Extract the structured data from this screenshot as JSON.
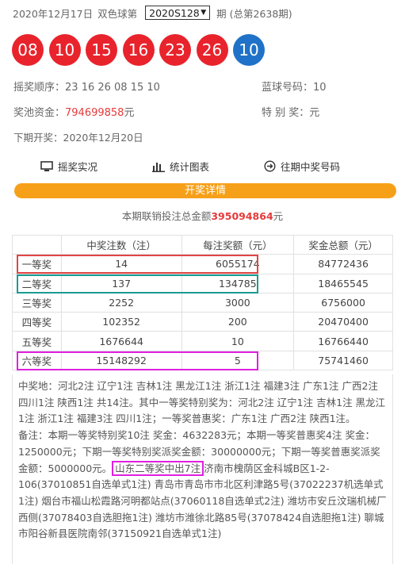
{
  "header": {
    "date": "2020年12月17日",
    "game": "双色球第",
    "issue": "2020S128",
    "suffix": "期 (总第2638期)"
  },
  "balls": {
    "red": [
      "08",
      "10",
      "15",
      "16",
      "23",
      "26"
    ],
    "blue": "10"
  },
  "draw_order": {
    "label": "摇奖顺序：",
    "value": "23 16 26 08 15 10"
  },
  "blue_number": {
    "label": "蓝球号码：",
    "value": "10"
  },
  "jackpot": {
    "label": "奖池资金：",
    "value": "794699858",
    "unit": "元"
  },
  "special_prize": {
    "label": "特 别 奖：",
    "unit": "元"
  },
  "next_draw": {
    "label": "下期开奖：",
    "value": "2020年12月20日"
  },
  "menu": {
    "live": "摇奖实况",
    "stats": "统计图表",
    "history": "往期中奖号码"
  },
  "details_button": "开奖详情",
  "sales": {
    "prefix": "本期联销投注总金额",
    "value": "395094864",
    "unit": "元"
  },
  "table": {
    "headers": [
      "",
      "中奖注数（注）",
      "每注奖额（元）",
      "奖金总额（元）"
    ],
    "rows": [
      [
        "一等奖",
        "14",
        "6055174",
        "84772436"
      ],
      [
        "二等奖",
        "137",
        "134785",
        "18465545"
      ],
      [
        "三等奖",
        "2252",
        "3000",
        "6756000"
      ],
      [
        "四等奖",
        "102352",
        "200",
        "20470400"
      ],
      [
        "五等奖",
        "1676644",
        "10",
        "16766440"
      ],
      [
        "六等奖",
        "15148292",
        "5",
        "75741460"
      ]
    ]
  },
  "info": {
    "p1": "中奖地：河北2注 辽宁1注 吉林1注 黑龙江1注 浙江1注 福建3注 广东1注 广西2注 四川1注 陕西1注 共14注。其中一等奖特别奖为：河北2注 辽宁1注 吉林1注 黑龙江1注 浙江1注 福建3注 四川1注；一等奖普惠奖：广东1注 广西2注 陕西1注。",
    "p2a": "备注：本期一等奖特别奖10注 奖金：4632283元；本期一等奖普惠奖4注 奖金：1250000元；下期一等奖特别奖派奖金额：30000000元；下期一等奖普惠奖派奖金额：5000000元。",
    "p2b": "山东二等奖中出7注",
    "p2c": "济南市槐荫区金科城B区1-2-106(37010851自选单式1注) 青岛市青岛市市北区利津路5号(37022237机选单式1注) 烟台市福山松霞路河明都站点(37060118自选单式2注) 潍坊市安丘汶瑞机械厂西侧(37078403自选胆拖1注) 潍坊市潍徐北路85号(37078424自选胆拖1注) 聊城市阳谷新县医院南邻(37150921自选单式1注)"
  },
  "colors": {
    "red_ball": "#e8232c",
    "blue_ball": "#1f72c7",
    "accent_orange": "#f6a019",
    "highlight_red": "#e04545",
    "highlight_teal": "#1a9b92",
    "highlight_magenta": "#e020e0"
  }
}
